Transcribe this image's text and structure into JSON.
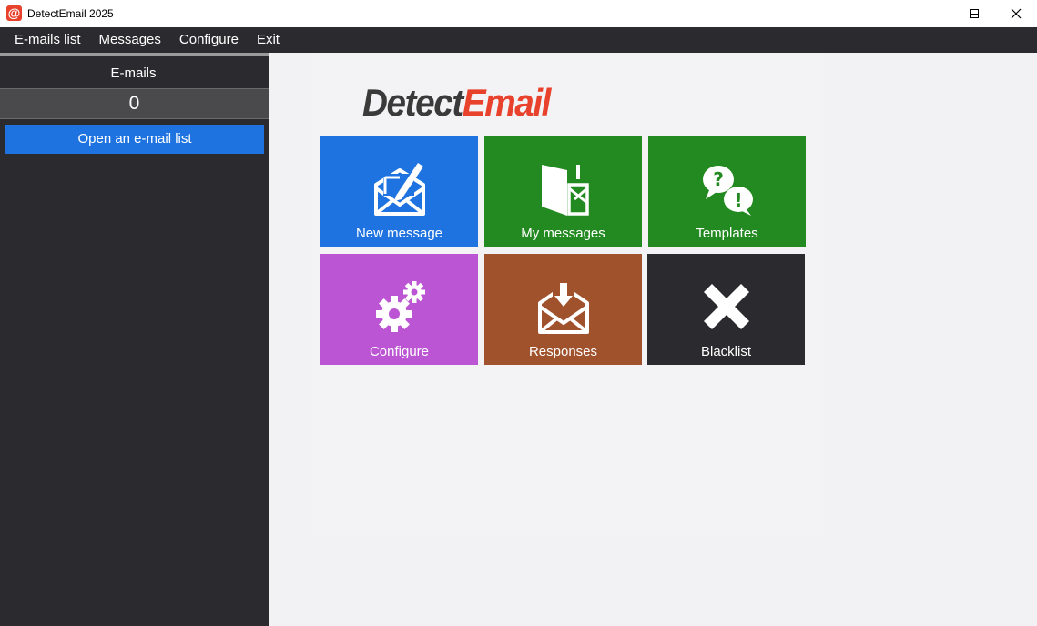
{
  "window": {
    "app_icon_glyph": "@",
    "title": "DetectEmail 2025"
  },
  "menu": [
    {
      "label": "E-mails list"
    },
    {
      "label": "Messages"
    },
    {
      "label": "Configure"
    },
    {
      "label": "Exit"
    }
  ],
  "sidebar": {
    "title": "E-mails",
    "count": "0",
    "open_button": "Open an e-mail list"
  },
  "logo": {
    "part1": "Detect",
    "part2": "Email"
  },
  "tiles": [
    {
      "label": "New message",
      "icon": "envelope-pencil-icon",
      "color": "#1e73e0"
    },
    {
      "label": "My messages",
      "icon": "open-envelope-icon",
      "color": "#238a21"
    },
    {
      "label": "Templates",
      "icon": "speech-bubbles-icon",
      "color": "#238a21"
    },
    {
      "label": "Configure",
      "icon": "gears-icon",
      "color": "#bb55d3"
    },
    {
      "label": "Responses",
      "icon": "envelope-download-icon",
      "color": "#a0522d"
    },
    {
      "label": "Blacklist",
      "icon": "x-cross-icon",
      "color": "#2b2b2f"
    }
  ]
}
